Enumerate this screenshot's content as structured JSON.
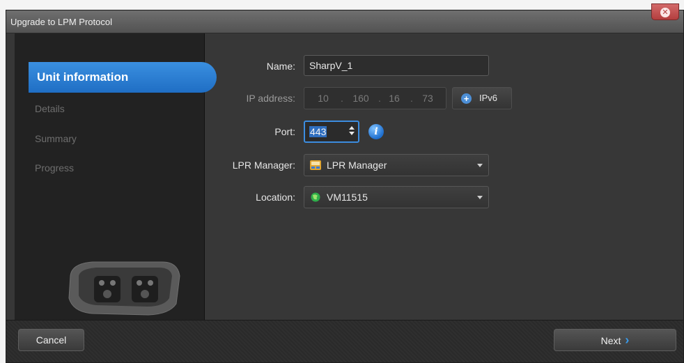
{
  "window": {
    "title": "Upgrade to LPM Protocol"
  },
  "sidebar": {
    "items": [
      {
        "label": "Unit information",
        "active": true
      },
      {
        "label": "Details",
        "active": false
      },
      {
        "label": "Summary",
        "active": false
      },
      {
        "label": "Progress",
        "active": false
      }
    ]
  },
  "form": {
    "name_label": "Name:",
    "name_value": "SharpV_1",
    "ip_label": "IP address:",
    "ip_segments": [
      "10",
      "160",
      "16",
      "73"
    ],
    "ipv6_label": "IPv6",
    "port_label": "Port:",
    "port_value": "443",
    "lpr_manager_label": "LPR Manager:",
    "lpr_manager_value": "LPR Manager",
    "location_label": "Location:",
    "location_value": "VM11515"
  },
  "footer": {
    "cancel_label": "Cancel",
    "next_label": "Next"
  },
  "colors": {
    "accent": "#2f7fd6",
    "background": "#373737",
    "sidebar": "#222222"
  }
}
